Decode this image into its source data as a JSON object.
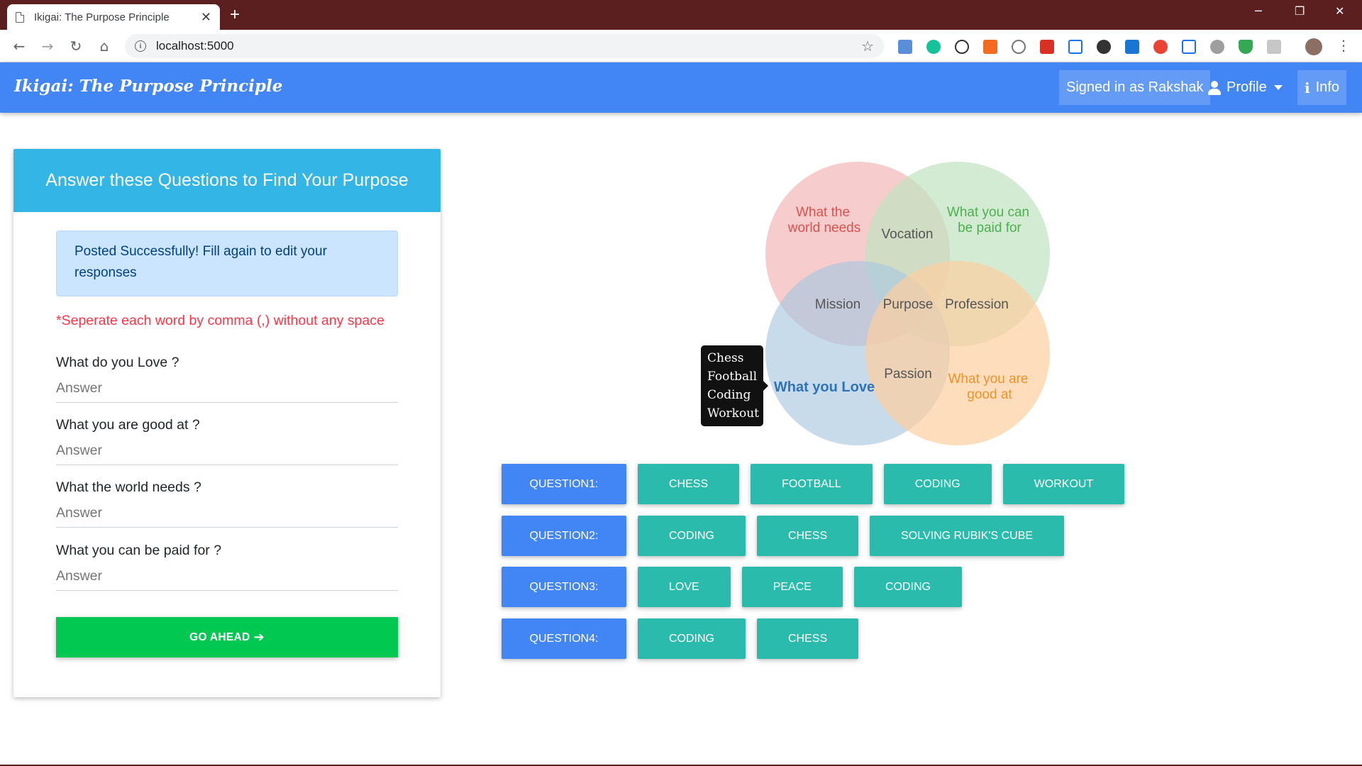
{
  "browser": {
    "tab_title": "Ikigai: The Purpose Principle",
    "tab_close": "✕",
    "new_tab": "+",
    "url": "localhost:5000",
    "win_min": "─",
    "win_max": "❐",
    "win_close": "✕"
  },
  "navbar": {
    "brand": "Ikigai: The Purpose Principle",
    "signed_in": "Signed in as Rakshak",
    "profile": "Profile",
    "info": "Info"
  },
  "card": {
    "header": "Answer these Questions to Find Your Purpose",
    "alert": "Posted Successfully! Fill again to edit your responses",
    "hint": "*Seperate each word by comma (,) without any space",
    "questions": [
      {
        "label": "What do you Love ?",
        "placeholder": "Answer"
      },
      {
        "label": "What you are good at ?",
        "placeholder": "Answer"
      },
      {
        "label": "What the world needs ?",
        "placeholder": "Answer"
      },
      {
        "label": "What you can be paid for ?",
        "placeholder": "Answer"
      }
    ],
    "submit": "GO AHEAD"
  },
  "venn": {
    "world_needs_line1": "What the",
    "world_needs_line2": "world needs",
    "paid_for_line1": "What you can",
    "paid_for_line2": "be paid for",
    "love": "What you Love",
    "good_at_line1": "What you are",
    "good_at_line2": "good at",
    "vocation": "Vocation",
    "mission": "Mission",
    "purpose": "Purpose",
    "profession": "Profession",
    "passion": "Passion",
    "colors": {
      "world_needs": "#f3b6b6",
      "paid_for": "#bfe3bf",
      "love": "#a9c8e0",
      "good_at": "#fdcfa0"
    },
    "tooltip": [
      "Chess",
      "Football",
      "Coding",
      "Workout"
    ]
  },
  "answers": [
    {
      "label": "QUESTION1:",
      "items": [
        "CHESS",
        "FOOTBALL",
        "CODING",
        "WORKOUT"
      ]
    },
    {
      "label": "QUESTION2:",
      "items": [
        "CODING",
        "CHESS",
        "SOLVING RUBIK'S CUBE"
      ]
    },
    {
      "label": "QUESTION3:",
      "items": [
        "LOVE",
        "PEACE",
        "CODING"
      ]
    },
    {
      "label": "QUESTION4:",
      "items": [
        "CODING",
        "CHESS"
      ]
    }
  ]
}
